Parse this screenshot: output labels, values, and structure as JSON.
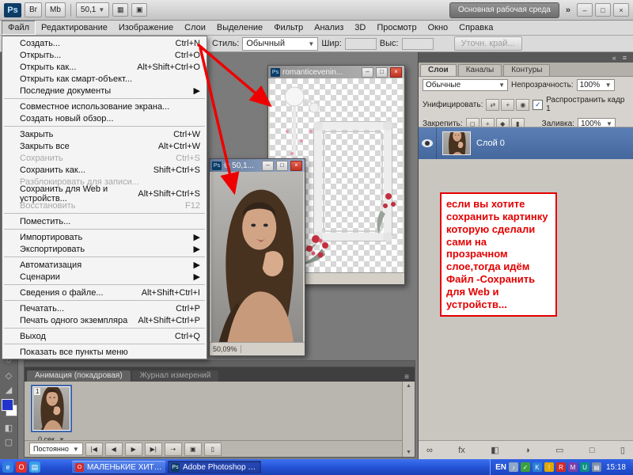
{
  "app": {
    "titlebar": {
      "ps_logo": "Ps",
      "bridge_button": "Br",
      "minibridge_button": "Mb",
      "zoom_value": "50,1",
      "icon_buttons": [
        {
          "name": "view-extras-icon",
          "glyph": "▦"
        },
        {
          "name": "arrange-documents-icon",
          "glyph": "▣"
        }
      ],
      "workspace_button": "Основная рабочая среда",
      "overflow_chevron": "»",
      "window_buttons": [
        {
          "name": "minimize-button",
          "glyph": "–"
        },
        {
          "name": "restore-button",
          "glyph": "□"
        },
        {
          "name": "close-button",
          "glyph": "×"
        }
      ]
    },
    "menubar": {
      "items": [
        "Файл",
        "Редактирование",
        "Изображение",
        "Слои",
        "Выделение",
        "Фильтр",
        "Анализ",
        "3D",
        "Просмотр",
        "Окно",
        "Справка"
      ],
      "active": "Файл"
    },
    "options_bar": {
      "style_label": "Стиль:",
      "style_value": "Обычный",
      "width_label": "Шир:",
      "height_label": "Выс:",
      "refine_edge_button": "Уточн. край..."
    }
  },
  "file_menu": {
    "items": [
      {
        "label": "Создать...",
        "shortcut": "Ctrl+N"
      },
      {
        "label": "Открыть...",
        "shortcut": "Ctrl+O"
      },
      {
        "label": "Открыть как...",
        "shortcut": "Alt+Shift+Ctrl+O"
      },
      {
        "label": "Открыть как смарт-объект..."
      },
      {
        "label": "Последние документы",
        "submenu": true
      },
      {
        "separator": true
      },
      {
        "label": "Совместное использование экрана..."
      },
      {
        "label": "Создать новый обзор..."
      },
      {
        "separator": true
      },
      {
        "label": "Закрыть",
        "shortcut": "Ctrl+W"
      },
      {
        "label": "Закрыть все",
        "shortcut": "Alt+Ctrl+W"
      },
      {
        "label": "Сохранить",
        "shortcut": "Ctrl+S",
        "disabled": true
      },
      {
        "label": "Сохранить как...",
        "shortcut": "Shift+Ctrl+S"
      },
      {
        "label": "Разблокировать для записи...",
        "disabled": true
      },
      {
        "label": "Сохранить для Web и устройств...",
        "shortcut": "Alt+Shift+Ctrl+S"
      },
      {
        "label": "Восстановить",
        "shortcut": "F12",
        "disabled": true
      },
      {
        "separator": true
      },
      {
        "label": "Поместить..."
      },
      {
        "separator": true
      },
      {
        "label": "Импортировать",
        "submenu": true
      },
      {
        "label": "Экспортировать",
        "submenu": true
      },
      {
        "separator": true
      },
      {
        "label": "Автоматизация",
        "submenu": true
      },
      {
        "label": "Сценарии",
        "submenu": true
      },
      {
        "separator": true
      },
      {
        "label": "Сведения о файле...",
        "shortcut": "Alt+Shift+Ctrl+I"
      },
      {
        "separator": true
      },
      {
        "label": "Печатать...",
        "shortcut": "Ctrl+P"
      },
      {
        "label": "Печать одного экземпляра",
        "shortcut": "Alt+Shift+Ctrl+P"
      },
      {
        "separator": true
      },
      {
        "label": "Выход",
        "shortcut": "Ctrl+Q"
      },
      {
        "separator": true
      },
      {
        "label": "Показать все пункты меню"
      }
    ]
  },
  "doc1": {
    "title": "romanticevenin..."
  },
  "doc2": {
    "title": "© 50,1...",
    "zoom_status": "50,09%"
  },
  "layers_panel": {
    "tabs": [
      "Слои",
      "Каналы",
      "Контуры"
    ],
    "strip_icons": [
      {
        "name": "collapse-panels-icon",
        "glyph": "«"
      },
      {
        "name": "panel-menu-icon",
        "glyph": "≡"
      }
    ],
    "blend_mode": "Обычные",
    "opacity_label": "Непрозрачность:",
    "opacity_value": "100%",
    "unify_label": "Унифицировать:",
    "unify_icons": [
      {
        "name": "unify-position-icon",
        "glyph": "⇄"
      },
      {
        "name": "unify-visibility-icon",
        "glyph": "+"
      },
      {
        "name": "unify-style-icon",
        "glyph": "◉"
      }
    ],
    "propagate_label": "Распространить кадр 1",
    "propagate_checked": "✓",
    "lock_label": "Закрепить:",
    "lock_icons": [
      {
        "name": "lock-transparency-icon",
        "glyph": "◻"
      },
      {
        "name": "lock-pixels-icon",
        "glyph": "+"
      },
      {
        "name": "lock-position-icon",
        "glyph": "◆"
      },
      {
        "name": "lock-all-icon",
        "glyph": "▮"
      }
    ],
    "fill_label": "Заливка:",
    "fill_value": "100%",
    "layer_name": "Слой 0",
    "bottom_icons": [
      {
        "name": "link-layers-icon",
        "glyph": "∞"
      },
      {
        "name": "layer-style-icon",
        "glyph": "fx"
      },
      {
        "name": "layer-mask-icon",
        "glyph": "◧"
      },
      {
        "name": "adjustment-layer-icon",
        "glyph": "◑"
      },
      {
        "name": "layer-group-icon",
        "glyph": "▭"
      },
      {
        "name": "new-layer-icon",
        "glyph": "□"
      },
      {
        "name": "delete-layer-icon",
        "glyph": "▯"
      }
    ]
  },
  "annotation": {
    "text": "если вы хотите сохранить картинку которую сделали сами на прозрачном слое,тогда идём Файл -Сохранить для Web и устройств...",
    "accent_color": "#e40000"
  },
  "animation_panel": {
    "tabs": [
      "Анимация (покадровая)",
      "Журнал измерений"
    ],
    "frame_number": "1",
    "frame_time": "0 сек.",
    "time_caret": "▼",
    "loop_value": "Постоянно",
    "controls": [
      {
        "name": "first-frame-button",
        "glyph": "|◀"
      },
      {
        "name": "prev-frame-button",
        "glyph": "◀"
      },
      {
        "name": "play-button",
        "glyph": "▶"
      },
      {
        "name": "next-frame-button",
        "glyph": "▶|"
      },
      {
        "name": "tween-button",
        "glyph": "⇢"
      },
      {
        "name": "duplicate-frame-button",
        "glyph": "▣"
      },
      {
        "name": "delete-frame-button",
        "glyph": "▯"
      }
    ]
  },
  "taskbar": {
    "quick_launch": [
      {
        "name": "browser-icon",
        "glyph": "e",
        "bg": "#2f7fe0"
      },
      {
        "name": "opera-icon",
        "glyph": "O",
        "bg": "#e03030"
      },
      {
        "name": "show-desktop-icon",
        "glyph": "▤",
        "bg": "#3aa0e8"
      }
    ],
    "tasks": [
      {
        "title": "МАЛЕНЬКИЕ ХИТРОС...",
        "icon_glyph": "O",
        "icon_bg": "#d42a2a",
        "active": false
      },
      {
        "title": "Adobe Photoshop CS...",
        "icon_glyph": "Ps",
        "icon_bg": "#0d3d66",
        "active": true
      }
    ],
    "language": "EN",
    "tray_icons": [
      {
        "name": "volume-icon",
        "glyph": "♪",
        "bg": "#8fa6c8"
      },
      {
        "name": "antivirus-icon",
        "glyph": "✓",
        "bg": "#3da03d"
      },
      {
        "name": "messenger-icon",
        "glyph": "K",
        "bg": "#2b7fd4"
      },
      {
        "name": "update-icon",
        "glyph": "!",
        "bg": "#e0a800"
      },
      {
        "name": "r-app-icon",
        "glyph": "R",
        "bg": "#d42a2a"
      },
      {
        "name": "m-app-icon",
        "glyph": "M",
        "bg": "#7b3fa8"
      },
      {
        "name": "u-app-icon",
        "glyph": "U",
        "bg": "#0d8f84"
      },
      {
        "name": "network-icon",
        "glyph": "▤",
        "bg": "#7d8fa8"
      }
    ],
    "time": "15:18"
  }
}
